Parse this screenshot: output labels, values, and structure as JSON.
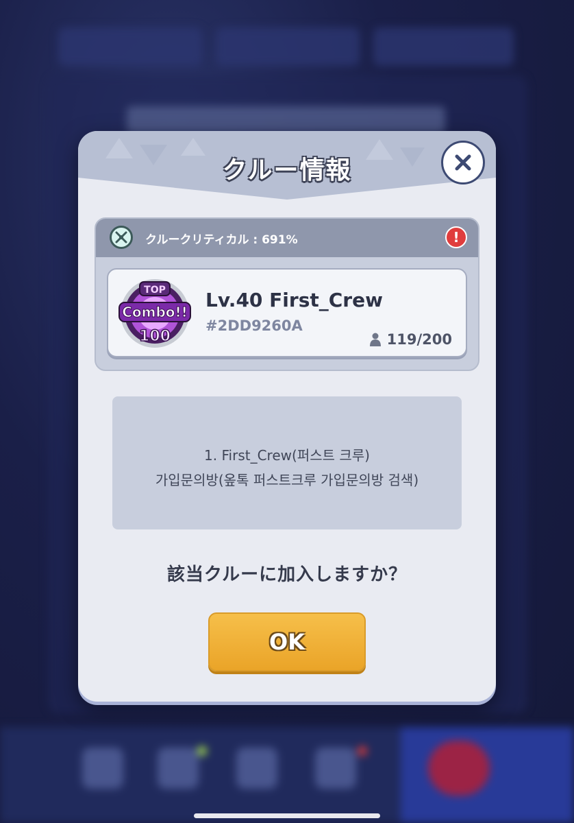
{
  "dialog": {
    "title": "クルー情報",
    "close_icon": "close-icon"
  },
  "crew": {
    "critical_label": "クルークリティカル : 691%",
    "critical_icon": "sword-burst-icon",
    "alert_icon": "exclamation-alert-icon",
    "emblem": {
      "top_text": "TOP",
      "main_text": "Combo!!",
      "number": "100"
    },
    "name": "Lv.40 First_Crew",
    "id": "#2DD9260A",
    "members": "119/200",
    "member_icon": "person-icon"
  },
  "description": {
    "line1": "1.  First_Crew(퍼스트 크루)",
    "line2": "가입문의방(옾톡 퍼스트크루 가입문의방 검색)"
  },
  "question": "該当クルーに加入しますか？",
  "ok_label": "OK",
  "colors": {
    "ok_button": "#f2b23a",
    "header": "#b7bfd3",
    "alert": "#e03d3d"
  }
}
